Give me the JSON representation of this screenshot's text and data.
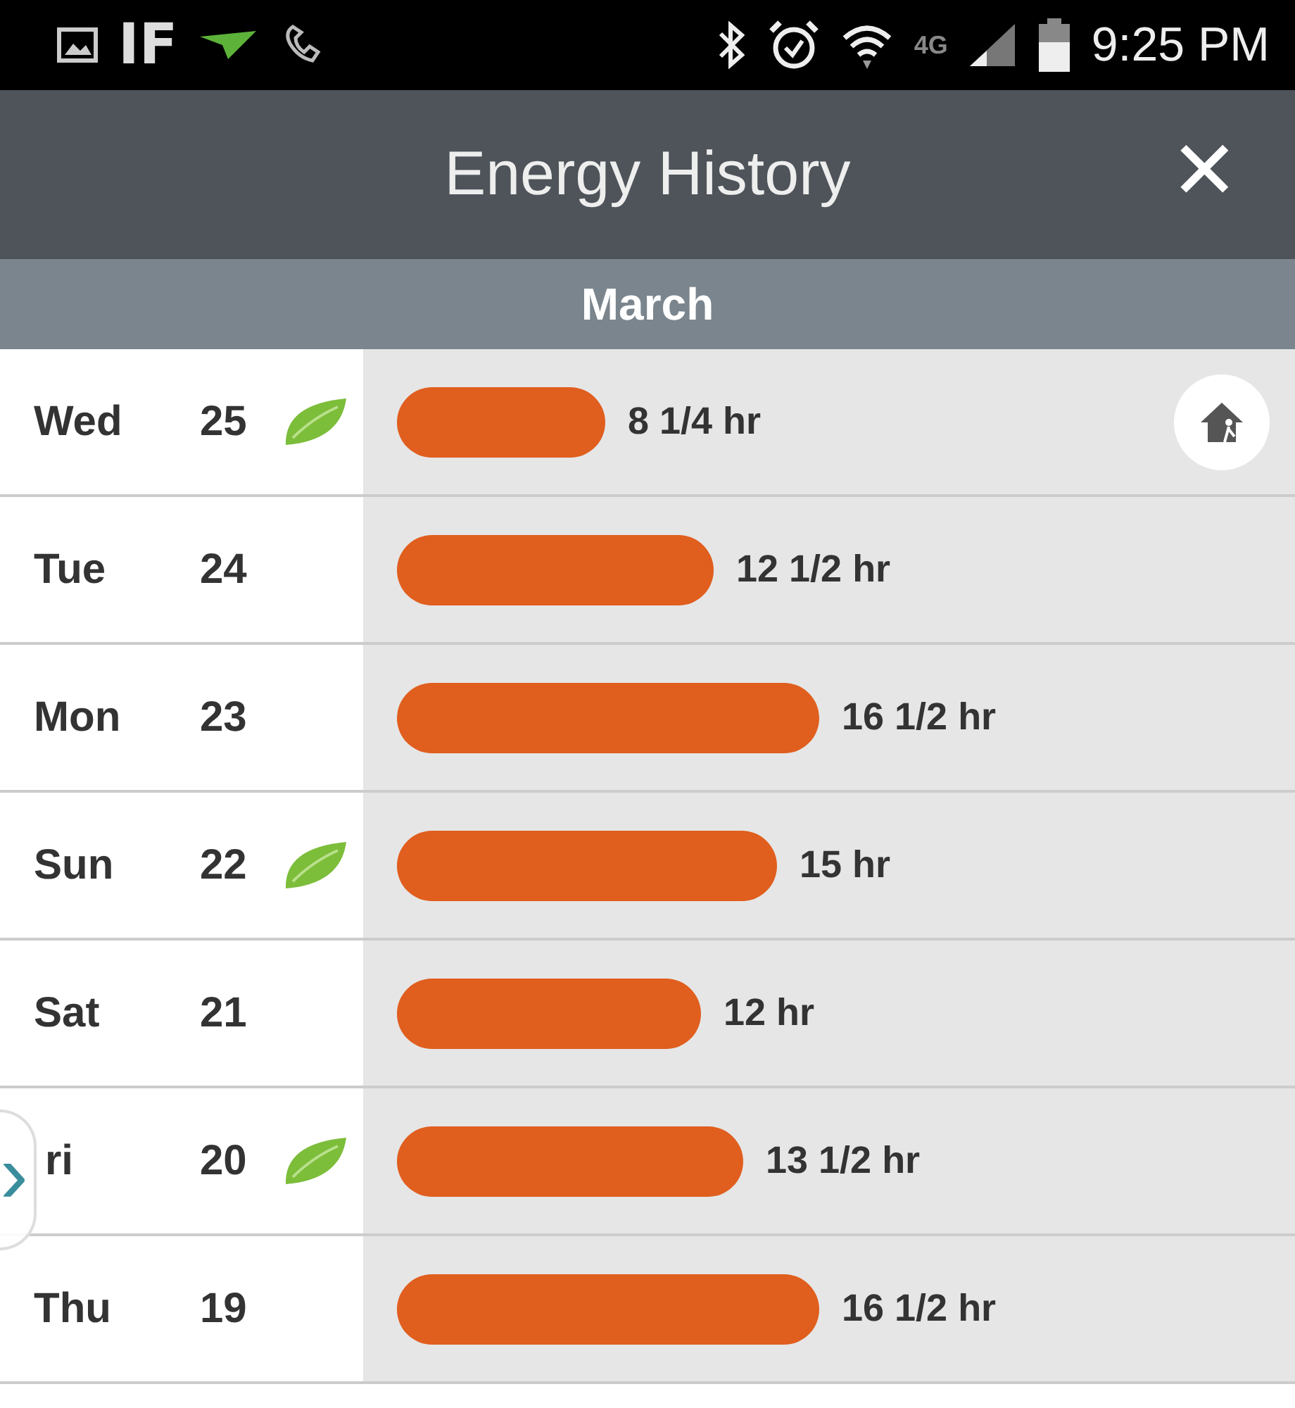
{
  "status_bar": {
    "carrier_text": "IF",
    "network": "4G",
    "time": "9:25 PM"
  },
  "header": {
    "title": "Energy History",
    "close": "✕"
  },
  "month": "March",
  "side_tab": {
    "glyph": "›"
  },
  "days": [
    {
      "day": "Wed",
      "date": "25",
      "leaf": true,
      "reading": "8 1/4 hr",
      "home": true
    },
    {
      "day": "Tue",
      "date": "24",
      "leaf": false,
      "reading": "12 1/2 hr",
      "home": false
    },
    {
      "day": "Mon",
      "date": "23",
      "leaf": false,
      "reading": "16 1/2 hr",
      "home": false
    },
    {
      "day": "Sun",
      "date": "22",
      "leaf": true,
      "reading": "15 hr",
      "home": false
    },
    {
      "day": "Sat",
      "date": "21",
      "leaf": false,
      "reading": "12 hr",
      "home": false
    },
    {
      "day": "ri",
      "date": "20",
      "leaf": true,
      "reading": "13 1/2 hr",
      "home": false
    },
    {
      "day": "Thu",
      "date": "19",
      "leaf": false,
      "reading": "16 1/2 hr",
      "home": false
    }
  ]
}
